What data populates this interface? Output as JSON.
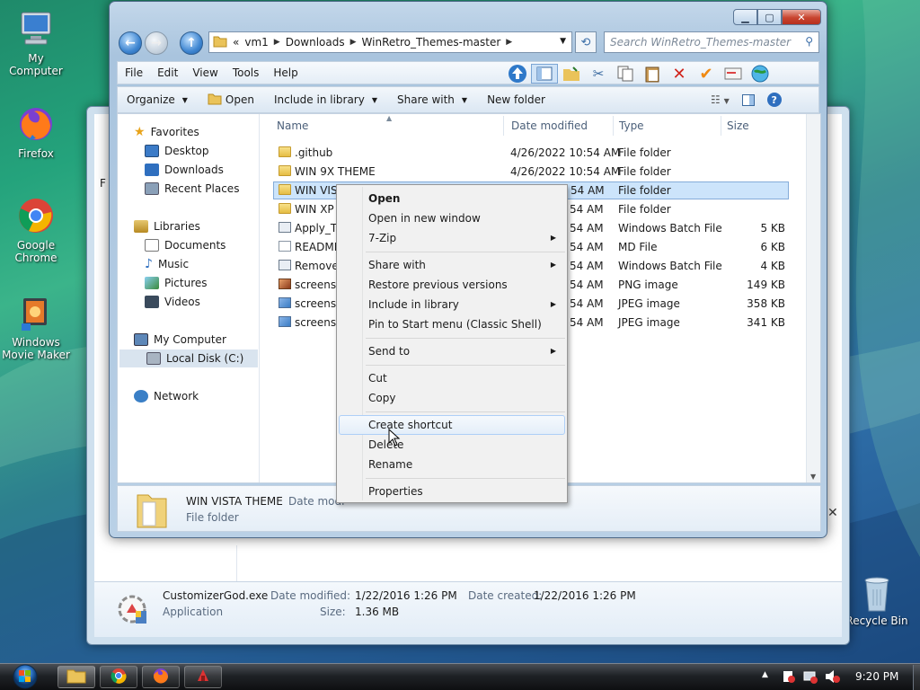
{
  "desktop": {
    "icons": [
      {
        "label": "My Computer",
        "icon": "computer-icon"
      },
      {
        "label": "Firefox",
        "icon": "firefox-icon"
      },
      {
        "label": "Google Chrome",
        "icon": "chrome-icon"
      },
      {
        "label": "Windows Movie Maker",
        "icon": "movie-maker-icon"
      },
      {
        "label": "Recycle Bin",
        "icon": "recycle-bin-icon"
      }
    ]
  },
  "background_window": {
    "sidebar_fragment": "F",
    "details": {
      "name": "CustomizerGod.exe",
      "type": "Application",
      "modified_label": "Date modified:",
      "modified_value": "1/22/2016 1:26 PM",
      "created_label": "Date created:",
      "created_value": "1/22/2016 1:26 PM",
      "size_label": "Size:",
      "size_value": "1.36 MB"
    }
  },
  "window": {
    "address": {
      "prefix": "«",
      "segments": [
        "vm1",
        "Downloads",
        "WinRetro_Themes-master"
      ]
    },
    "search_placeholder": "Search WinRetro_Themes-master",
    "menu": [
      "File",
      "Edit",
      "View",
      "Tools",
      "Help"
    ],
    "commands": {
      "organize": "Organize",
      "open": "Open",
      "include": "Include in library",
      "share": "Share with",
      "new_folder": "New folder"
    },
    "nav_pane": {
      "favorites": "Favorites",
      "desktop": "Desktop",
      "downloads": "Downloads",
      "recent": "Recent Places",
      "libraries": "Libraries",
      "documents": "Documents",
      "music": "Music",
      "pictures": "Pictures",
      "videos": "Videos",
      "computer": "My Computer",
      "local_disk": "Local Disk (C:)",
      "network": "Network"
    },
    "columns": {
      "name": "Name",
      "date": "Date modified",
      "type": "Type",
      "size": "Size"
    },
    "files": [
      {
        "name": ".github",
        "date": "4/26/2022 10:54 AM",
        "type": "File folder",
        "size": "",
        "kind": "folder"
      },
      {
        "name": "WIN 9X THEME",
        "date": "4/26/2022 10:54 AM",
        "type": "File folder",
        "size": "",
        "kind": "folder"
      },
      {
        "name": "WIN VISTA THEME",
        "date": "54 AM",
        "type": "File folder",
        "size": "",
        "kind": "folder"
      },
      {
        "name": "WIN XP T",
        "date": "54 AM",
        "type": "File folder",
        "size": "",
        "kind": "folder"
      },
      {
        "name": "Apply_Th",
        "date": "54 AM",
        "type": "Windows Batch File",
        "size": "5 KB",
        "kind": "bat"
      },
      {
        "name": "README",
        "date": "54 AM",
        "type": "MD File",
        "size": "6 KB",
        "kind": "doc"
      },
      {
        "name": "Remove_",
        "date": "54 AM",
        "type": "Windows Batch File",
        "size": "4 KB",
        "kind": "bat"
      },
      {
        "name": "screensh",
        "date": "54 AM",
        "type": "PNG image",
        "size": "149 KB",
        "kind": "png"
      },
      {
        "name": "screensh",
        "date": "54 AM",
        "type": "JPEG image",
        "size": "358 KB",
        "kind": "img"
      },
      {
        "name": "screensh",
        "date": "54 AM",
        "type": "JPEG image",
        "size": "341 KB",
        "kind": "img"
      }
    ],
    "details": {
      "name": "WIN VISTA THEME",
      "label": "Date modi",
      "type": "File folder"
    }
  },
  "context_menu": {
    "open": "Open",
    "open_new_window": "Open in new window",
    "seven_zip": "7-Zip",
    "share_with": "Share with",
    "restore": "Restore previous versions",
    "include": "Include in library",
    "pin": "Pin to Start menu (Classic Shell)",
    "send_to": "Send to",
    "cut": "Cut",
    "copy": "Copy",
    "create_shortcut": "Create shortcut",
    "delete": "Delete",
    "rename": "Rename",
    "properties": "Properties",
    "highlighted": "Create shortcut"
  },
  "taskbar": {
    "clock": "9:20 PM"
  }
}
